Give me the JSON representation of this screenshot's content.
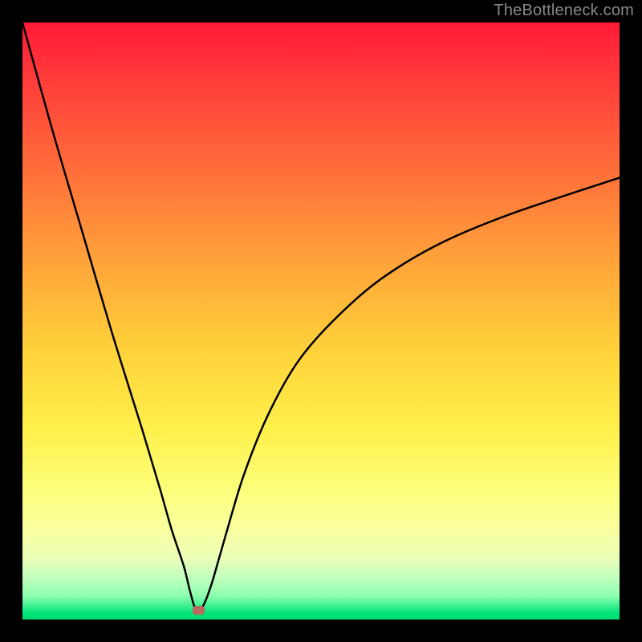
{
  "watermark": "TheBottleneck.com",
  "chart_data": {
    "type": "line",
    "title": "",
    "xlabel": "",
    "ylabel": "",
    "xlim": [
      0,
      100
    ],
    "ylim": [
      0,
      100
    ],
    "grid": false,
    "annotations": [
      {
        "type": "marker",
        "x": 29.5,
        "y": 1.5,
        "color": "#b96a5c"
      }
    ],
    "gradient_bands": [
      {
        "stop": 0,
        "color": "#ff1a38"
      },
      {
        "stop": 10,
        "color": "#ff3d3a"
      },
      {
        "stop": 25,
        "color": "#ff6f3a"
      },
      {
        "stop": 40,
        "color": "#ffa33a"
      },
      {
        "stop": 55,
        "color": "#ffd23a"
      },
      {
        "stop": 68,
        "color": "#fff04a"
      },
      {
        "stop": 78,
        "color": "#fdff7a"
      },
      {
        "stop": 85,
        "color": "#f9ffa0"
      },
      {
        "stop": 90,
        "color": "#e9ffb8"
      },
      {
        "stop": 93,
        "color": "#c0ffbf"
      },
      {
        "stop": 96,
        "color": "#8effae"
      },
      {
        "stop": 99,
        "color": "#00e47a"
      },
      {
        "stop": 100,
        "color": "#00d873"
      }
    ],
    "series": [
      {
        "name": "bottleneck-curve",
        "color": "#000000",
        "x": [
          0,
          5,
          10,
          15,
          20,
          23,
          25,
          27,
          28,
          28.8,
          29.5,
          30.2,
          31,
          32,
          34,
          37,
          41,
          46,
          52,
          60,
          70,
          82,
          100
        ],
        "y": [
          100,
          82,
          65,
          48,
          32,
          22,
          15,
          9,
          5,
          2.2,
          1.5,
          2.2,
          4,
          7,
          14,
          24,
          34,
          43,
          50,
          57,
          63,
          68,
          74
        ]
      }
    ]
  }
}
